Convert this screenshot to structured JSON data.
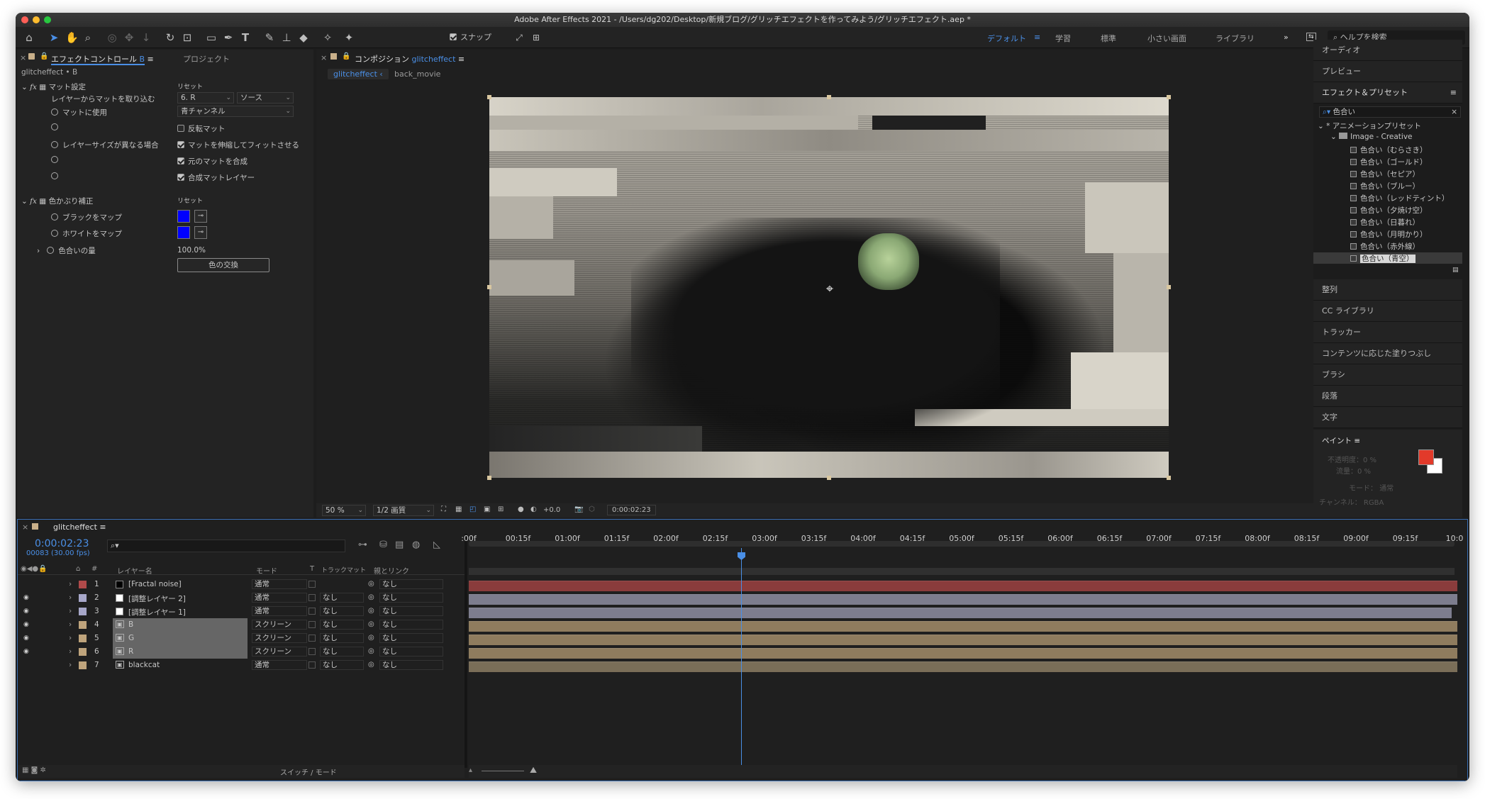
{
  "window": {
    "title": "Adobe After Effects 2021 - /Users/dg202/Desktop/新規ブログ/グリッチエフェクトを作ってみよう/グリッチエフェクト.aep *"
  },
  "toolbar": {
    "snap_label": "スナップ",
    "workspaces": [
      "デフォルト",
      "学習",
      "標準",
      "小さい画面",
      "ライブラリ"
    ],
    "search_placeholder": "ヘルプを検索"
  },
  "effect_panel": {
    "tab_effect": "エフェクトコントロール",
    "tab_effect_suffix": "B",
    "tab_project": "プロジェクト",
    "layer_path": "glitcheffect • B",
    "fx1": {
      "name": "マット設定",
      "reset": "リセット",
      "take_matte_label": "レイヤーからマットを取り込む",
      "take_matte_value": "6. R",
      "take_matte_source": "ソース",
      "use_label": "マットに使用",
      "use_value": "青チャンネル",
      "invert": "反転マット",
      "size_label": "レイヤーサイズが異なる場合",
      "stretch": "マットを伸縮してフィットさせる",
      "composite": "元のマットを合成",
      "premult": "合成マットレイヤー"
    },
    "fx2": {
      "name": "色かぶり補正",
      "reset": "リセット",
      "black_label": "ブラックをマップ",
      "white_label": "ホワイトをマップ",
      "amount_label": "色合いの量",
      "amount_value": "100.0%",
      "swap_button": "色の交換",
      "black_color": "#0000ff",
      "white_color": "#0000ff"
    }
  },
  "comp_panel": {
    "tab_label": "コンポジション",
    "tab_name": "glitcheffect",
    "breadcrumb": [
      "glitcheffect",
      "back_movie"
    ],
    "zoom": "50 %",
    "resolution": "1/2 画質",
    "exposure": "+0.0",
    "timecode": "0:00:02:23"
  },
  "right_panel": {
    "top_items": [
      "オーディオ",
      "プレビュー"
    ],
    "effects_title": "エフェクト＆プリセット",
    "search_value": "色合い",
    "tree_root": "* アニメーションプリセット",
    "tree_folder": "Image - Creative",
    "presets": [
      "色合い（むらさき）",
      "色合い（ゴールド）",
      "色合い（セピア）",
      "色合い（ブルー）",
      "色合い（レッドティント）",
      "色合い（夕焼け空）",
      "色合い（日暮れ）",
      "色合い（月明かり）",
      "色合い（赤外線）",
      "色合い（青空）"
    ],
    "bottom_items": [
      "整列",
      "CC ライブラリ",
      "トラッカー",
      "コンテンツに応じた塗りつぶし",
      "ブラシ",
      "段落",
      "文字"
    ],
    "paint": {
      "title": "ペイント",
      "opacity_label": "不透明度：",
      "opacity_value": "0 %",
      "flow_label": "流量：",
      "flow_value": "0 %",
      "mode_label": "モード：",
      "mode_value": "通常",
      "channel_label": "チャンネル：",
      "channel_value": "RGBA",
      "fg_color": "#e23a2a"
    }
  },
  "timeline": {
    "comp_tab": "glitcheffect",
    "timecode": "0:00:02:23",
    "frames": "00083 (30.00 fps)",
    "search_placeholder": "",
    "col_headers": {
      "name": "レイヤー名",
      "mode": "モード",
      "t": "T",
      "trkmat": "トラックマット",
      "parent": "親とリンク"
    },
    "ruler": [
      ":00f",
      "00:15f",
      "01:00f",
      "01:15f",
      "02:00f",
      "02:15f",
      "03:00f",
      "03:15f",
      "04:00f",
      "04:15f",
      "05:00f",
      "05:15f",
      "06:00f",
      "06:15f",
      "07:00f",
      "07:15f",
      "08:00f",
      "08:15f",
      "09:00f",
      "09:15f",
      "10:0"
    ],
    "layers": [
      {
        "num": "1",
        "name": "[Fractal noise]",
        "mode": "通常",
        "trkmat": "",
        "parent": "なし",
        "label_color": "#b04a4a",
        "bar_color": "#8a3c3c",
        "thumb": "black",
        "selected": false,
        "visible": false
      },
      {
        "num": "2",
        "name": "[調整レイヤー 2]",
        "mode": "通常",
        "trkmat": "なし",
        "parent": "なし",
        "label_color": "#a7a7c9",
        "bar_color": "#7d7d8e",
        "thumb": "white",
        "selected": false,
        "visible": true
      },
      {
        "num": "3",
        "name": "[調整レイヤー 1]",
        "mode": "通常",
        "trkmat": "なし",
        "parent": "なし",
        "label_color": "#a7a7c9",
        "bar_color": "#7d7d8e",
        "thumb": "white",
        "selected": false,
        "visible": true
      },
      {
        "num": "4",
        "name": "B",
        "mode": "スクリーン",
        "trkmat": "なし",
        "parent": "なし",
        "label_color": "#bfa47c",
        "bar_color": "#8f7c5e",
        "thumb": "film",
        "selected": true,
        "visible": true
      },
      {
        "num": "5",
        "name": "G",
        "mode": "スクリーン",
        "trkmat": "なし",
        "parent": "なし",
        "label_color": "#bfa47c",
        "bar_color": "#8f7c5e",
        "thumb": "film",
        "selected": true,
        "visible": true
      },
      {
        "num": "6",
        "name": "R",
        "mode": "スクリーン",
        "trkmat": "なし",
        "parent": "なし",
        "label_color": "#bfa47c",
        "bar_color": "#8f7c5e",
        "thumb": "film",
        "selected": true,
        "visible": true
      },
      {
        "num": "7",
        "name": "blackcat",
        "mode": "通常",
        "trkmat": "なし",
        "parent": "なし",
        "label_color": "#bfa47c",
        "bar_color": "#7a6e58",
        "thumb": "film",
        "selected": false,
        "visible": false
      }
    ],
    "footer_label": "スイッチ / モード"
  }
}
